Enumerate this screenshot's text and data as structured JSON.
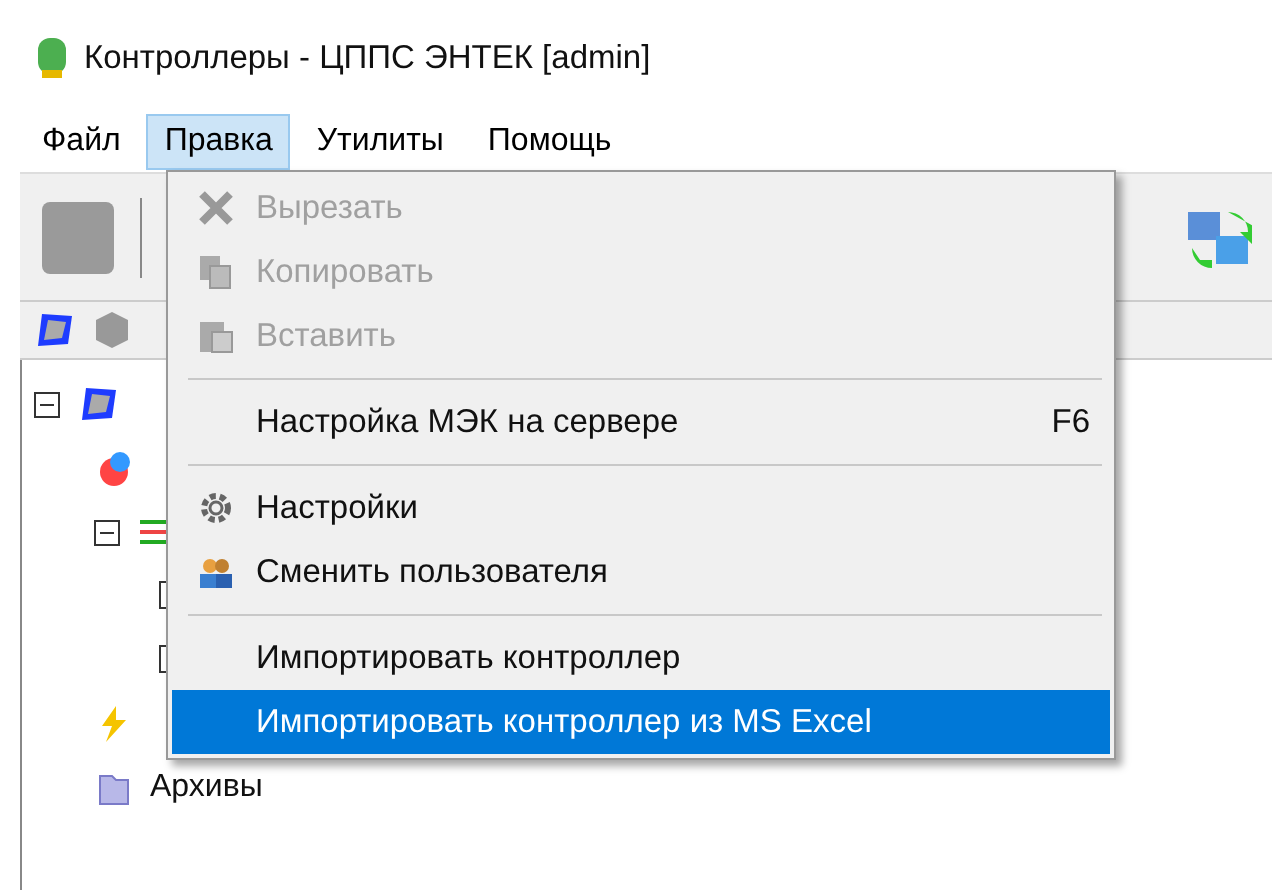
{
  "window": {
    "title": "Контроллеры - ЦППС ЭНТЕК [admin]"
  },
  "menubar": [
    {
      "label": "Файл",
      "selected": false
    },
    {
      "label": "Правка",
      "selected": true
    },
    {
      "label": "Утилиты",
      "selected": false
    },
    {
      "label": "Помощь",
      "selected": false
    }
  ],
  "menu": [
    {
      "kind": "cut",
      "label": "Вырезать",
      "disabled": true,
      "selected": false
    },
    {
      "kind": "copy",
      "label": "Копировать",
      "disabled": true,
      "selected": false
    },
    {
      "kind": "paste",
      "label": "Вставить",
      "disabled": true,
      "selected": false
    },
    {
      "kind": "separator"
    },
    {
      "kind": "plain",
      "label": "Настройка МЭК на сервере",
      "shortcut": "F6",
      "disabled": false,
      "selected": false
    },
    {
      "kind": "separator"
    },
    {
      "kind": "settings",
      "label": "Настройки",
      "disabled": false,
      "selected": false
    },
    {
      "kind": "users",
      "label": "Сменить пользователя",
      "disabled": false,
      "selected": false
    },
    {
      "kind": "separator"
    },
    {
      "kind": "plain",
      "label": "Импортировать контроллер",
      "disabled": false,
      "selected": false
    },
    {
      "kind": "plain",
      "label": "Импортировать контроллер из MS Excel",
      "disabled": false,
      "selected": true
    }
  ],
  "tree": [
    {
      "kind": "controller",
      "expanded": true,
      "children": [
        {
          "kind": "process"
        },
        {
          "kind": "group",
          "expanded": true,
          "children": [
            {
              "kind": "point"
            },
            {
              "kind": "point"
            }
          ]
        },
        {
          "kind": "event"
        },
        {
          "kind": "archive",
          "label": "Архивы"
        }
      ]
    }
  ]
}
